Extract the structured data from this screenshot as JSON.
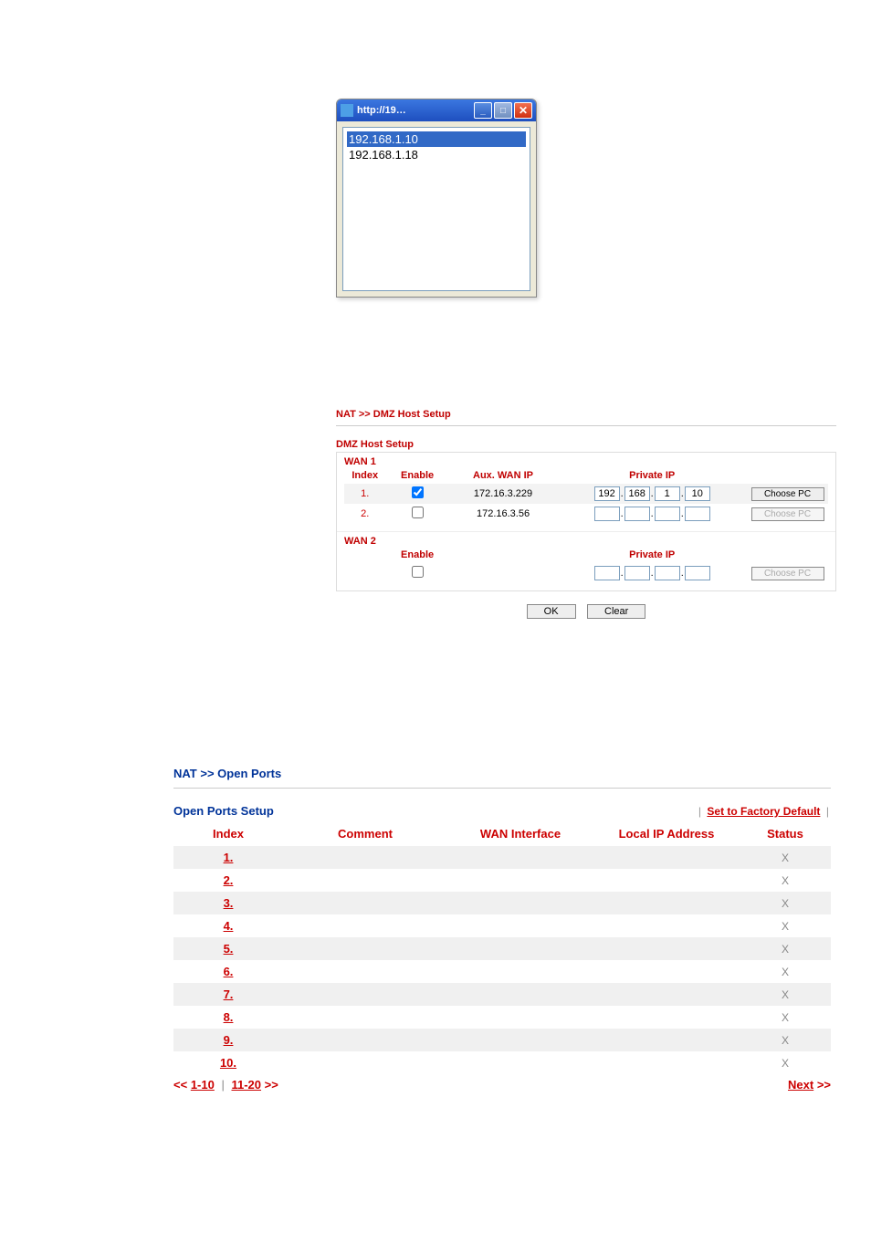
{
  "popup": {
    "title": "http://19…",
    "items": [
      "192.168.1.10",
      "192.168.1.18"
    ]
  },
  "dmz": {
    "breadcrumb": "NAT >> DMZ Host Setup",
    "panel_title": "DMZ Host Setup",
    "wan1": {
      "label": "WAN 1",
      "headers": {
        "index": "Index",
        "enable": "Enable",
        "aux": "Aux. WAN IP",
        "private": "Private IP"
      },
      "rows": [
        {
          "idx": "1.",
          "enabled": true,
          "aux": "172.16.3.229",
          "ip": [
            "192",
            "168",
            "1",
            "10"
          ],
          "choose_enabled": true,
          "choose_label": "Choose PC"
        },
        {
          "idx": "2.",
          "enabled": false,
          "aux": "172.16.3.56",
          "ip": [
            "",
            "",
            "",
            ""
          ],
          "choose_enabled": false,
          "choose_label": "Choose PC"
        }
      ]
    },
    "wan2": {
      "label": "WAN 2",
      "headers": {
        "enable": "Enable",
        "private": "Private IP"
      },
      "row": {
        "enabled": false,
        "ip": [
          "",
          "",
          "",
          ""
        ],
        "choose_enabled": false,
        "choose_label": "Choose PC"
      }
    },
    "buttons": {
      "ok": "OK",
      "clear": "Clear"
    }
  },
  "open_ports": {
    "breadcrumb": "NAT >> Open Ports",
    "panel_title": "Open Ports Setup",
    "factory_link": "Set to Factory Default",
    "headers": {
      "index": "Index",
      "comment": "Comment",
      "wan": "WAN Interface",
      "local": "Local IP Address",
      "status": "Status"
    },
    "rows": [
      {
        "idx": "1.",
        "comment": "",
        "wan": "",
        "local": "",
        "status": "X"
      },
      {
        "idx": "2.",
        "comment": "",
        "wan": "",
        "local": "",
        "status": "X"
      },
      {
        "idx": "3.",
        "comment": "",
        "wan": "",
        "local": "",
        "status": "X"
      },
      {
        "idx": "4.",
        "comment": "",
        "wan": "",
        "local": "",
        "status": "X"
      },
      {
        "idx": "5.",
        "comment": "",
        "wan": "",
        "local": "",
        "status": "X"
      },
      {
        "idx": "6.",
        "comment": "",
        "wan": "",
        "local": "",
        "status": "X"
      },
      {
        "idx": "7.",
        "comment": "",
        "wan": "",
        "local": "",
        "status": "X"
      },
      {
        "idx": "8.",
        "comment": "",
        "wan": "",
        "local": "",
        "status": "X"
      },
      {
        "idx": "9.",
        "comment": "",
        "wan": "",
        "local": "",
        "status": "X"
      },
      {
        "idx": "10.",
        "comment": "",
        "wan": "",
        "local": "",
        "status": "X"
      }
    ],
    "pager": {
      "prev": "<<",
      "r1": "1-10",
      "r2": "11-20",
      "next_arrow": ">>",
      "next": "Next"
    }
  }
}
